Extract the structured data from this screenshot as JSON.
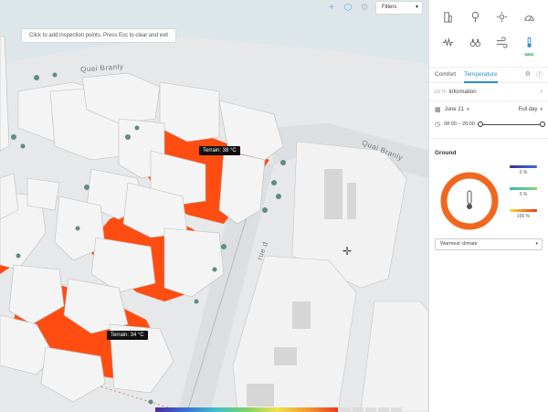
{
  "toolbar": {
    "filters_label": "Filters",
    "icons": [
      "crosshair-icon",
      "cube-icon",
      "layers-icon"
    ]
  },
  "map": {
    "hint": "Click to add inspection points. Press Esc to clear and exit",
    "street_labels": [
      "Quai Branly",
      "Quai Branly",
      "rue d"
    ],
    "tooltips": [
      {
        "label": "Terrain: 38 °C"
      },
      {
        "label": "Terrain: 34 °C"
      }
    ],
    "colors": {
      "hot": "#ff4d12",
      "building": "#f4f4f4",
      "ground": "#e4e6e7",
      "tree": "#5f8c82"
    }
  },
  "panel": {
    "analysis_icons": [
      {
        "name": "buildings-icon"
      },
      {
        "name": "trees-icon"
      },
      {
        "name": "sun-icon"
      },
      {
        "name": "sky-view-icon"
      },
      {
        "name": "noise-icon"
      },
      {
        "name": "binoculars-icon"
      },
      {
        "name": "wind-icon"
      },
      {
        "name": "thermometer-icon",
        "badge": "NEW",
        "active": true
      }
    ],
    "tabs": [
      {
        "label": "Comfort",
        "active": false
      },
      {
        "label": "Temperature",
        "active": true
      }
    ],
    "info": {
      "prefix": "EETh",
      "label": "Information"
    },
    "date": {
      "label": "June 21",
      "period": "Full day"
    },
    "time": {
      "range": "08:00 – 20:00",
      "start_fraction": 0.0,
      "end_fraction": 1.0
    },
    "section_title": "Ground",
    "ground": {
      "legend": [
        {
          "value": "0 %",
          "gradient": "linear-gradient(to right,#3b2d8f,#3d6fd9)"
        },
        {
          "value": "0 %",
          "gradient": "linear-gradient(to right,#2fb8b8,#8ed36b)"
        },
        {
          "value": "100 %",
          "gradient": "linear-gradient(to right,#f3df3f,#f0862a,#e83c1e)"
        }
      ],
      "hot_fraction": 1.0,
      "ring_color": "#f06820"
    },
    "climate_select": "Warmest climate"
  }
}
